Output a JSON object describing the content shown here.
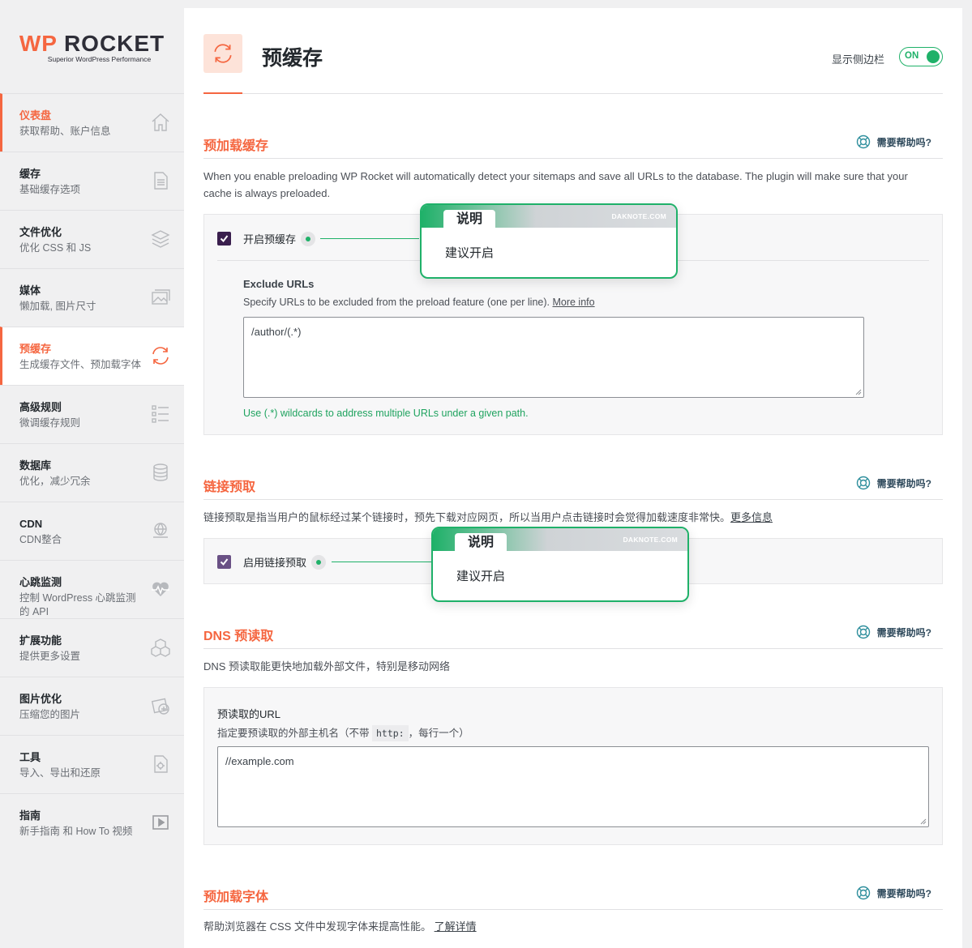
{
  "brand": {
    "name_wp": "WP",
    "name_rocket": "ROCKET",
    "tagline": "Superior WordPress Performance",
    "accent": "#f56640",
    "green": "#1fb169"
  },
  "sidebar": {
    "items": [
      {
        "title": "仪表盘",
        "desc": "获取帮助、账户信息",
        "icon": "home-icon"
      },
      {
        "title": "缓存",
        "desc": "基础缓存选项",
        "icon": "document-icon"
      },
      {
        "title": "文件优化",
        "desc": "优化 CSS 和 JS",
        "icon": "layers-icon"
      },
      {
        "title": "媒体",
        "desc": "懒加载, 图片尺寸",
        "icon": "images-icon"
      },
      {
        "title": "预缓存",
        "desc": "生成缓存文件、预加载字体",
        "icon": "refresh-icon"
      },
      {
        "title": "高级规则",
        "desc": "微调缓存规则",
        "icon": "list-icon"
      },
      {
        "title": "数据库",
        "desc": "优化，减少冗余",
        "icon": "database-icon"
      },
      {
        "title": "CDN",
        "desc": "CDN整合",
        "icon": "globe-icon"
      },
      {
        "title": "心跳监测",
        "desc": "控制 WordPress 心跳监测的 API",
        "icon": "heartbeat-icon"
      },
      {
        "title": "扩展功能",
        "desc": "提供更多设置",
        "icon": "boxes-icon"
      },
      {
        "title": "图片优化",
        "desc": "压缩您的图片",
        "icon": "image-optimize-icon"
      },
      {
        "title": "工具",
        "desc": "导入、导出和还原",
        "icon": "tools-icon"
      },
      {
        "title": "指南",
        "desc": "新手指南 和 How To 视频",
        "icon": "video-icon"
      }
    ]
  },
  "header": {
    "title": "预缓存",
    "sidebar_toggle_label": "显示侧边栏",
    "toggle_state": "ON"
  },
  "sections": {
    "preload": {
      "title": "预加载缓存",
      "help": "需要帮助吗?",
      "desc": "When you enable preloading WP Rocket will automatically detect your sitemaps and save all URLs to the database. The plugin will make sure that your cache is always preloaded.",
      "checkbox_label": "开启预缓存",
      "checked": true,
      "exclude_label": "Exclude URLs",
      "exclude_help": "Specify URLs to be excluded from the preload feature (one per line).",
      "exclude_more": "More info",
      "exclude_value": "/author/(.*)",
      "note": "Use (.*) wildcards to address multiple URLs under a given path."
    },
    "link_prefetch": {
      "title": "链接预取",
      "help": "需要帮助吗?",
      "desc": "链接预取是指当用户的鼠标经过某个链接时，预先下载对应网页，所以当用户点击链接时会觉得加载速度非常快。",
      "desc_link": "更多信息",
      "checkbox_label": "启用链接预取",
      "checked": true
    },
    "dns": {
      "title": "DNS 预读取",
      "help": "需要帮助吗?",
      "desc": "DNS 预读取能更快地加载外部文件，特别是移动网络",
      "field_label": "预读取的URL",
      "field_help_pre": "指定要预读取的外部主机名（不带",
      "field_help_code": "http:",
      "field_help_post": "，每行一个）",
      "value": "//example.com"
    },
    "fonts": {
      "title": "预加载字体",
      "help": "需要帮助吗?",
      "desc": "帮助浏览器在 CSS 文件中发现字体来提高性能。",
      "desc_link": "了解详情"
    }
  },
  "callouts": [
    {
      "tab": "说明",
      "site": "DAKNOTE.COM",
      "body": "建议开启"
    },
    {
      "tab": "说明",
      "site": "DAKNOTE.COM",
      "body": "建议开启"
    }
  ]
}
